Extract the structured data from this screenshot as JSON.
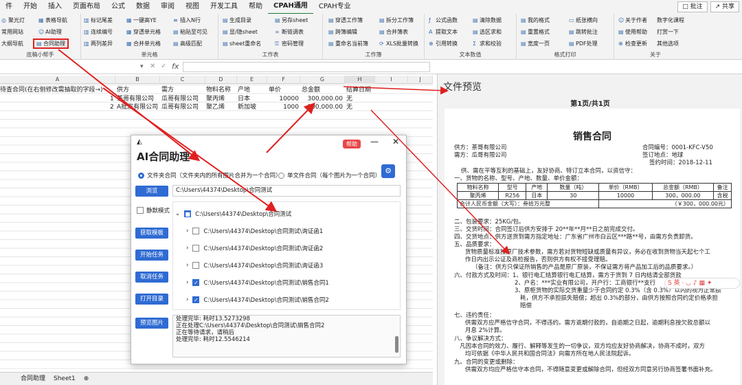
{
  "menu": {
    "items": [
      "件",
      "开始",
      "插入",
      "页面布局",
      "公式",
      "数据",
      "审阅",
      "视图",
      "开发工具",
      "帮助",
      "CPAH通用",
      "CPAH专业"
    ],
    "comment_btn": "批注",
    "share_btn": "共享"
  },
  "ribbon": {
    "g1": {
      "b1": "聚光灯",
      "b2": "表格导航",
      "b3": "常用网站",
      "b4": "AI助理",
      "b5": "大纲导航",
      "b6": "合同助理",
      "label": "底稿小帮手"
    },
    "g2": {
      "b1": "标记尾差",
      "b2": "一键高YE",
      "b3": "插入N行",
      "b4": "连续编号",
      "b5": "穿透单元格",
      "b6": "粘贴至可见",
      "b7": "两列差异",
      "b8": "合并单元格",
      "b9": "高级匹配",
      "label": "单元格"
    },
    "g3": {
      "b1": "生成目录",
      "b2": "另存sheet",
      "b3": "显/隐sheet",
      "b4": "断链调表",
      "b5": "sheet重命名",
      "b6": "密码管理",
      "label": "工作表"
    },
    "g4": {
      "b1": "穿透工作簿",
      "b2": "拆分工作簿",
      "b3": "跨簿编辑",
      "b4": "合并簿表",
      "b5": "重命名当前簿",
      "b6": "XLS批量转换",
      "label": "工作簿"
    },
    "g5": {
      "b1": "公式函数",
      "b2": "清除数据",
      "b3": "提取文本",
      "b4": "选区求和",
      "b5": "引用转换",
      "b6": "求和校验",
      "label": "文本数值"
    },
    "g6": {
      "b1": "我的格式",
      "b2": "纸张横向",
      "b3": "重置格式",
      "b4": "跳转批注",
      "b5": "宽度一页",
      "b6": "PDF处理",
      "label": "格式打印"
    },
    "g7": {
      "b1": "关于作者",
      "b2": "数字化课程",
      "b3": "使用帮助",
      "b4": "打赏一下",
      "b5": "检查更新",
      "b6": "其他选项",
      "label": "关于"
    }
  },
  "formula": {
    "fx": "fx"
  },
  "columns": [
    "A",
    "B",
    "C",
    "D",
    "E",
    "F",
    "G",
    "H",
    "I",
    "J"
  ],
  "sheet": {
    "a1": "待查合同(在右侧修改需抽取的字段→)",
    "headers": [
      "供方",
      "需方",
      "物料名称",
      "产地",
      "单价",
      "总金额",
      "结算日期"
    ],
    "rows": [
      [
        "1",
        "茶哥有限公司",
        "瓜哥有限公司",
        "聚丙烯",
        "日本",
        "10000",
        "300,000.00",
        "无"
      ],
      [
        "2",
        "A批发有限公司",
        "瓜哥有限公司",
        "聚乙烯",
        "新加坡",
        "1000",
        "300,000.00",
        "无"
      ]
    ]
  },
  "tabs": {
    "t1": "合同助理",
    "t2": "Sheet1"
  },
  "preview": {
    "title": "文件预览",
    "page": "第1页/共1页",
    "doc_title": "销售合同",
    "supplier": "供方：茶哥有限公司",
    "buyer": "需方：瓜哥有限公司",
    "contract_no": "合同编号：0001-KFC-V50",
    "sign_place": "签订地点：地球",
    "sign_time": "签约时间：2018-12-11",
    "intro": "供、需在平等互利的基础上，友好协商、特订立本合同，以资信守：",
    "item1": "一、货物的名称、型号、产地、数量、单价金额：",
    "thead": [
      "物料名称",
      "型号",
      "产地",
      "数量（吨）",
      "单价（RMB）",
      "总金额（RMB）",
      "备注"
    ],
    "trow": [
      "聚丙烯",
      "R256",
      "日本",
      "30",
      "10000",
      "300，000.00",
      "含税"
    ],
    "total": "合计人民币金额（大写）：叁拾万元整",
    "total_num": "（￥300，000.00元）",
    "l2": "二、包装要求：25KG/包。",
    "l3": "三、交货时间：合同签订后供方安排于 20**年**月**日之前完成交付。",
    "l4": "四、交货地点：供方送货到需方指定地址：广东省广州市白云区***路**号，由需方负责卸货。",
    "l5": "五、品质要求：",
    "l5a": "货物质量标准按原厂技术参数，需方若对货物短缺或质量有异议，务必在收到货物当天起七个工",
    "l5b": "作日内出示公证及商检报告，否则供方有权不接受理赔。",
    "l5c": "（备注：供方只保证所销售的产品是原厂原装，不保证需方将产品加工后的品质要求。）",
    "l6": "六、付款方式及时间：1、银行电汇结算银行电汇结算，需方于货到 7 日内结清全部货款",
    "l6b": "2、户名：***实业有限公司，开户行：工商银行**支行",
    "l6c": "3、原柜货物的实际交货重量少于合同约定 0.3%（含 0.3%）以内的视为正常损",
    "l6d": "耗，供方不承担损失赔偿；超出 0.3%的部分，由供方按照合同约定价格承担",
    "l6e": "赔偿",
    "l7": "七、违约责任：",
    "l7a": "供需双方应严格信守合同，不得违约。需方逾期付款的，自逾期之日起，逾期利息按欠款总额以",
    "l7b": "月息 2%计算。",
    "l8": "八、争议解决方式：",
    "l8a": "凡因本合同的效力、履行、解释等发生的一切争议，双方均应友好协商解决，协商不成时，双方",
    "l8b": "均可依据《中华人民共和国合同法》向需方所在地人民法院起诉。",
    "l9": "九、合同的变更或删除：",
    "l9a": "供需双方均应严格信守本合同，不得随意变更或解除合同，但经双方同意另行协商签署书面补充。"
  },
  "dialog": {
    "help": "帮助",
    "title": "AI合同助理",
    "opt1": "文件夹合同（文件夹内的所有图片合并为一个合同）",
    "opt2": "单文件合同（每个图片为一个合同）",
    "browse": "浏览",
    "path": "C:\\Users\\44374\\Desktop\\合同测试",
    "silent": "静默模式",
    "get_template": "获取模板",
    "start": "开始任务",
    "cancel": "取消任务",
    "open_dir": "打开目录",
    "preview": "预览图片",
    "tree": [
      "C:\\Users\\44374\\Desktop\\合同测试",
      "C:\\Users\\44374\\Desktop\\合同测试\\询证函1",
      "C:\\Users\\44374\\Desktop\\合同测试\\询证函2",
      "C:\\Users\\44374\\Desktop\\合同测试\\询证函3",
      "C:\\Users\\44374\\Desktop\\合同测试\\销售合同1",
      "C:\\Users\\44374\\Desktop\\合同测试\\销售合同2"
    ],
    "log": [
      "处理完毕: 耗时13.5273298",
      "正在处理C:\\Users\\44374\\Desktop\\合同测试\\销售合同2",
      "正在等待请求，请稍后",
      "处理完毕: 耗时12.5546214"
    ]
  },
  "accent": {
    "green": "#1f7a3a",
    "blue": "#2f6bd3",
    "red": "#e02020"
  }
}
